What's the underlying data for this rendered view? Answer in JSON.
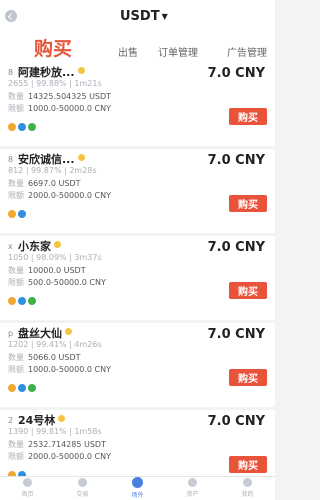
{
  "header": {
    "currency": "USDT"
  },
  "tabs": {
    "buy": "购买",
    "sell": "出售",
    "orders": "订单管理",
    "ads": "广告管理"
  },
  "labels": {
    "qty": "数量",
    "limit": "限额",
    "buy_button": "购买"
  },
  "listings": [
    {
      "rank": "8",
      "name": "阿建秒放...",
      "stats": "2655 | 99.88% | 1m21s",
      "qty": "14325.504325 USDT",
      "limit": "1000.0-50000.0 CNY",
      "price": "7.0 CNY",
      "payments": [
        "bank",
        "alipay",
        "wechat"
      ]
    },
    {
      "rank": "8",
      "name": "安欣诚信...",
      "stats": "812 | 99.87% | 2m28s",
      "qty": "6697.0 USDT",
      "limit": "2000.0-50000.0 CNY",
      "price": "7.0 CNY",
      "payments": [
        "bank",
        "alipay"
      ]
    },
    {
      "rank": "x",
      "name": "小东家",
      "stats": "1050 | 98.09% | 3m37s",
      "qty": "10000.0 USDT",
      "limit": "500.0-50000.0 CNY",
      "price": "7.0 CNY",
      "payments": [
        "bank",
        "alipay",
        "wechat"
      ]
    },
    {
      "rank": "p",
      "name": "盘丝大仙",
      "stats": "1202 | 99.41% | 4m26s",
      "qty": "5066.0 USDT",
      "limit": "1000.0-50000.0 CNY",
      "price": "7.0 CNY",
      "payments": [
        "bank",
        "alipay",
        "wechat"
      ]
    },
    {
      "rank": "2",
      "name": "24号林",
      "stats": "1390 | 99.81% | 1m58s",
      "qty": "2532.714285 USDT",
      "limit": "2000.0-50000.0 CNY",
      "price": "7.0 CNY",
      "payments": [
        "bank",
        "alipay"
      ]
    }
  ],
  "nav": [
    {
      "label": "首页",
      "icon": "home-icon",
      "active": false
    },
    {
      "label": "交易",
      "icon": "trade-icon",
      "active": false
    },
    {
      "label": "场外",
      "icon": "otc-icon",
      "active": true
    },
    {
      "label": "资产",
      "icon": "assets-icon",
      "active": false
    },
    {
      "label": "我的",
      "icon": "profile-icon",
      "active": false
    }
  ]
}
